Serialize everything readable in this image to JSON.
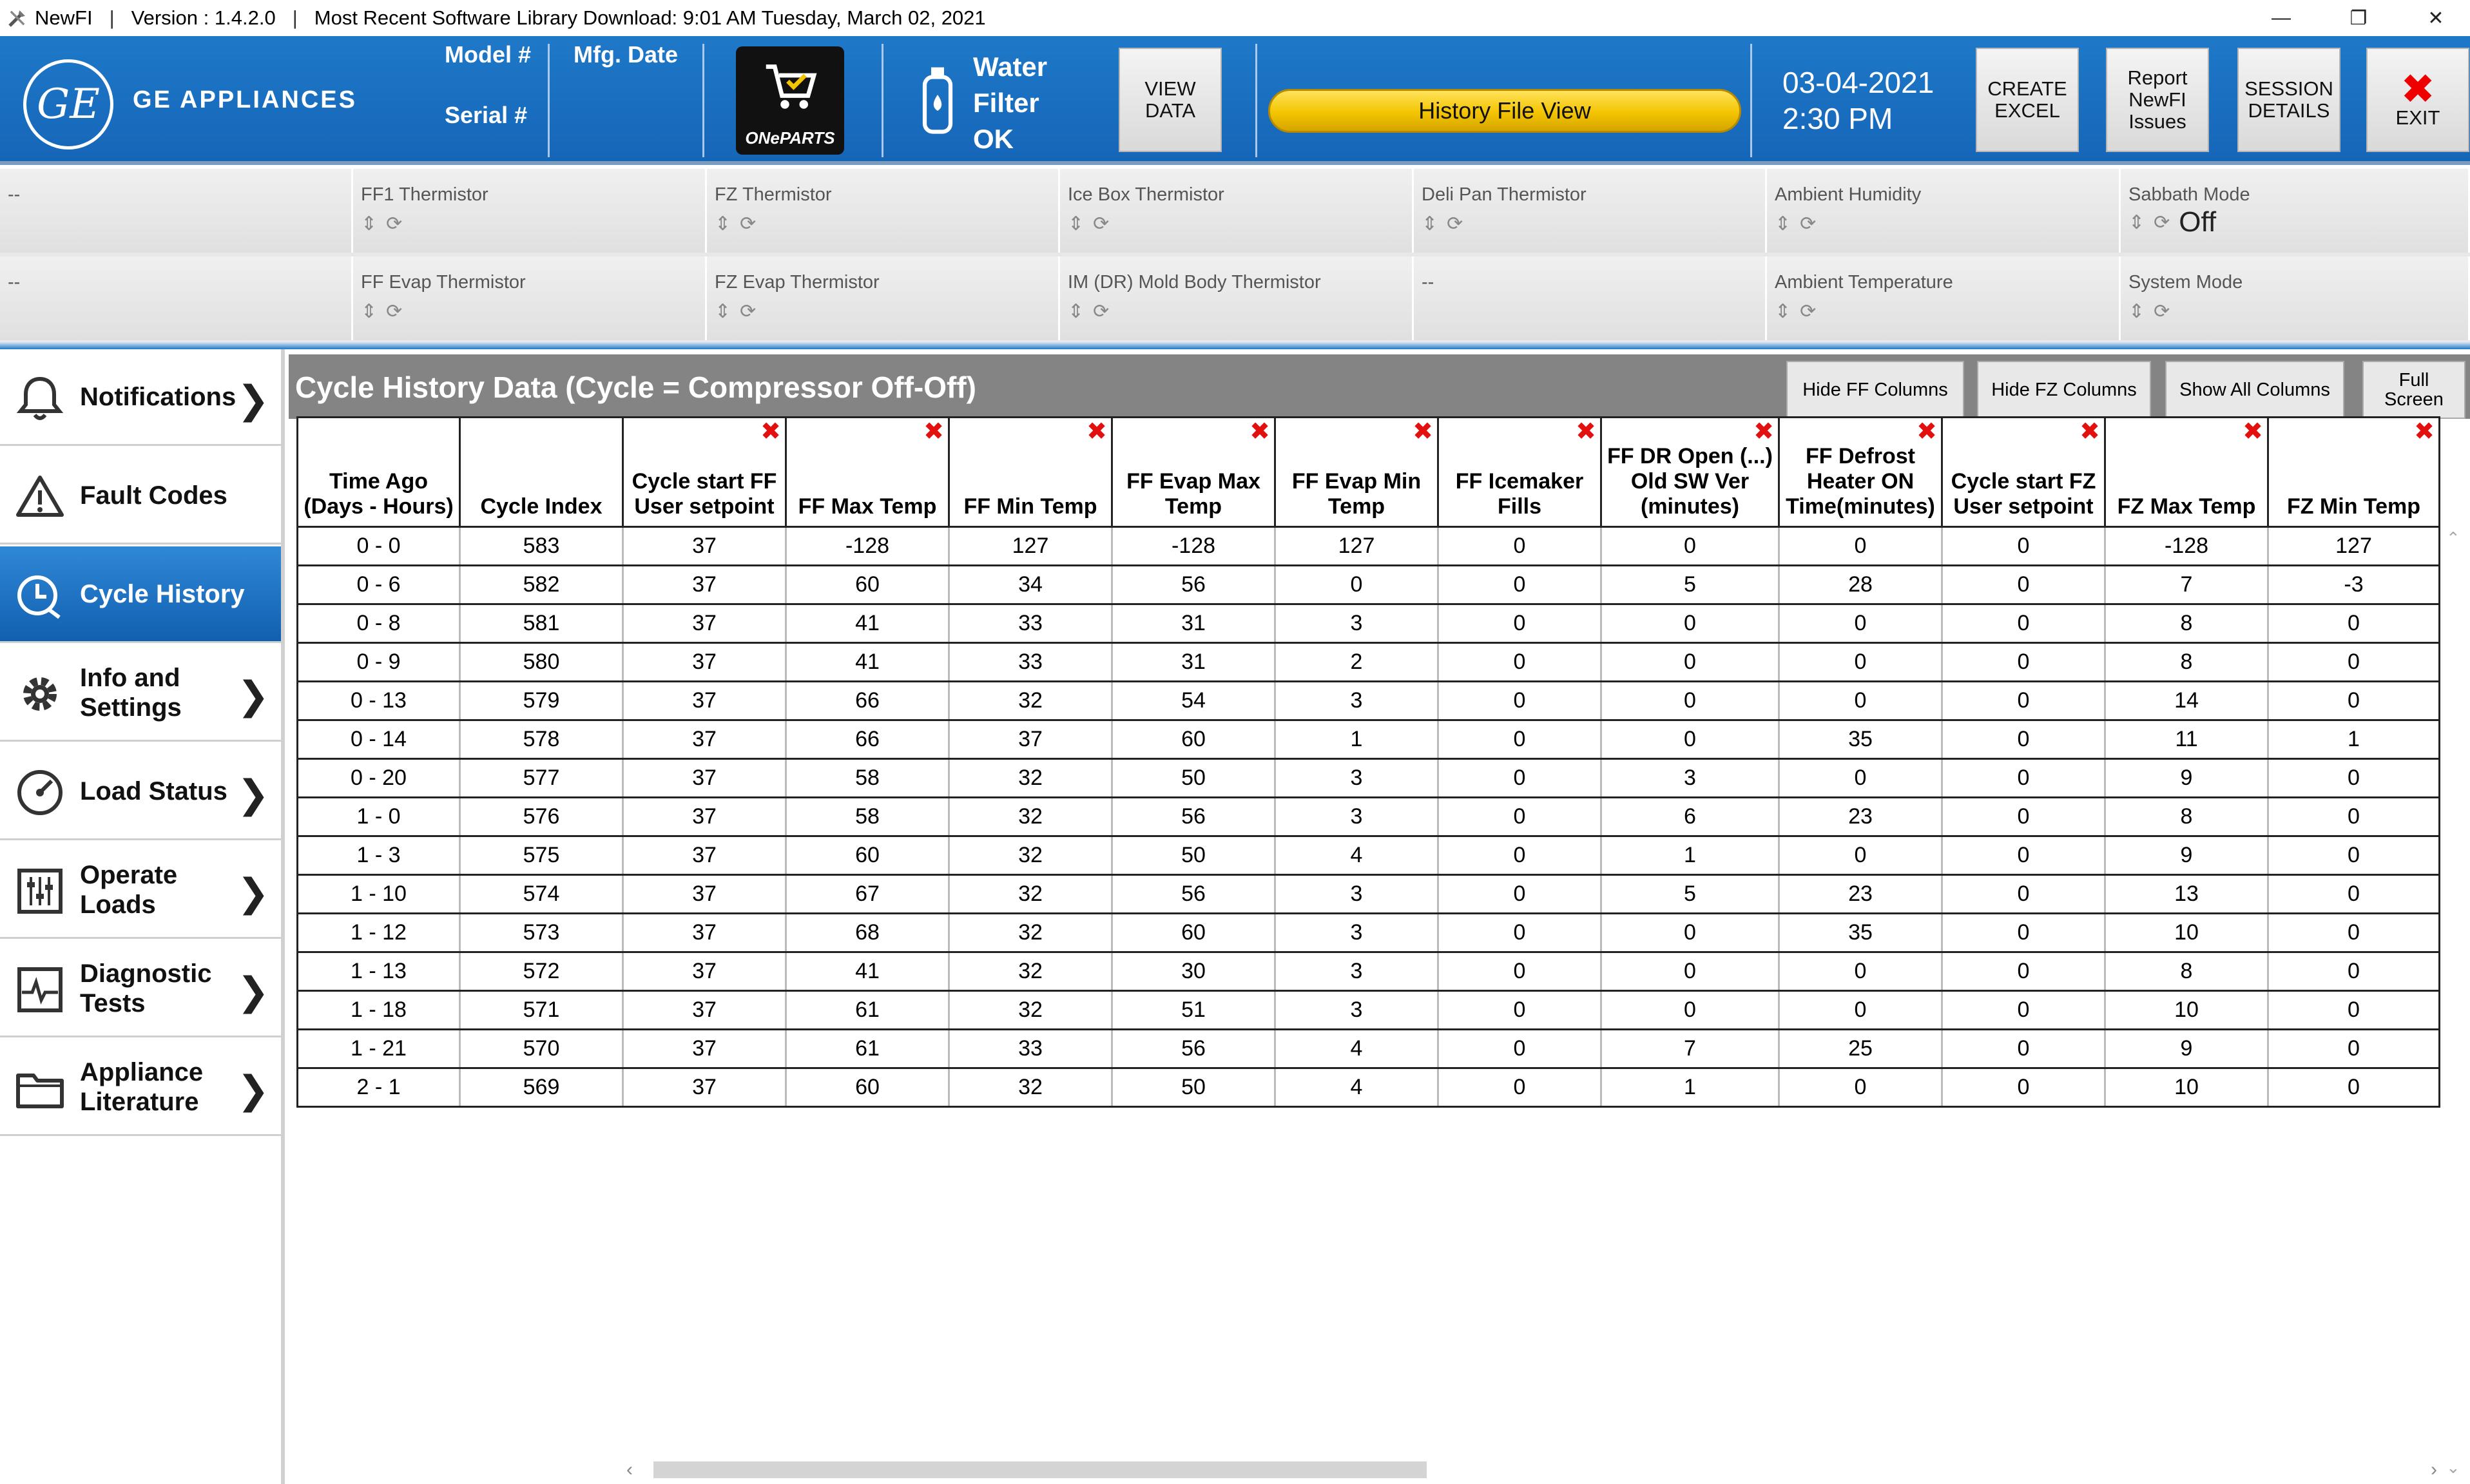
{
  "titlebar": {
    "app_name": "NewFI",
    "version": "Version : 1.4.2.0",
    "library_download": "Most Recent Software Library Download:  9:01 AM Tuesday, March 02, 2021"
  },
  "header": {
    "logo_text": "GE",
    "brand": "GE APPLIANCES",
    "model_label": "Model #",
    "serial_label": "Serial #",
    "mfg_label": "Mfg. Date",
    "oneparts_label": "ONePARTS",
    "water_line1": "Water",
    "water_line2": "Filter",
    "water_line3": "OK",
    "view_data": "VIEW\nDATA",
    "history_file": "History File View",
    "date": "03-04-2021",
    "time": "2:30 PM",
    "create_excel": "CREATE\nEXCEL",
    "report_issues": "Report\nNewFI\nIssues",
    "session_details": "SESSION\nDETAILS",
    "exit": "EXIT"
  },
  "status": {
    "row1": [
      {
        "label": "--",
        "value": ""
      },
      {
        "label": "FF1 Thermistor",
        "value": ""
      },
      {
        "label": "FZ Thermistor",
        "value": ""
      },
      {
        "label": "Ice Box Thermistor",
        "value": ""
      },
      {
        "label": "Deli Pan Thermistor",
        "value": ""
      },
      {
        "label": "Ambient Humidity",
        "value": ""
      },
      {
        "label": "Sabbath Mode",
        "value": "Off"
      }
    ],
    "row2": [
      {
        "label": "--",
        "value": ""
      },
      {
        "label": "FF Evap Thermistor",
        "value": ""
      },
      {
        "label": "FZ Evap Thermistor",
        "value": ""
      },
      {
        "label": "IM (DR) Mold Body Thermistor",
        "value": ""
      },
      {
        "label": "--",
        "value": ""
      },
      {
        "label": "Ambient Temperature",
        "value": ""
      },
      {
        "label": "System Mode",
        "value": ""
      }
    ]
  },
  "sidebar": {
    "items": [
      {
        "label": "Notifications"
      },
      {
        "label": "Fault Codes"
      },
      {
        "label": "Cycle History"
      },
      {
        "label": "Info and\nSettings"
      },
      {
        "label": "Load Status"
      },
      {
        "label": "Operate\nLoads"
      },
      {
        "label": "Diagnostic\nTests"
      },
      {
        "label": "Appliance\nLiterature"
      }
    ]
  },
  "grid": {
    "title": "Cycle History Data (Cycle = Compressor Off-Off)",
    "hide_ff": "Hide FF Columns",
    "hide_fz": "Hide FZ Columns",
    "show_all": "Show All Columns",
    "full_screen": "Full\nScreen",
    "columns": [
      "Time Ago (Days - Hours)",
      "Cycle Index",
      "Cycle start FF User setpoint",
      "FF Max Temp",
      "FF Min Temp",
      "FF Evap Max Temp",
      "FF Evap Min Temp",
      "FF Icemaker Fills",
      "FF DR Open (...) Old SW Ver (minutes)",
      "FF Defrost Heater ON Time(minutes)",
      "Cycle start FZ User setpoint",
      "FZ Max Temp",
      "FZ Min Temp"
    ],
    "rows": [
      [
        "0 - 0",
        "583",
        "37",
        "-128",
        "127",
        "-128",
        "127",
        "0",
        "0",
        "0",
        "0",
        "-128",
        "127"
      ],
      [
        "0 - 6",
        "582",
        "37",
        "60",
        "34",
        "56",
        "0",
        "0",
        "5",
        "28",
        "0",
        "7",
        "-3"
      ],
      [
        "0 - 8",
        "581",
        "37",
        "41",
        "33",
        "31",
        "3",
        "0",
        "0",
        "0",
        "0",
        "8",
        "0"
      ],
      [
        "0 - 9",
        "580",
        "37",
        "41",
        "33",
        "31",
        "2",
        "0",
        "0",
        "0",
        "0",
        "8",
        "0"
      ],
      [
        "0 - 13",
        "579",
        "37",
        "66",
        "32",
        "54",
        "3",
        "0",
        "0",
        "0",
        "0",
        "14",
        "0"
      ],
      [
        "0 - 14",
        "578",
        "37",
        "66",
        "37",
        "60",
        "1",
        "0",
        "0",
        "35",
        "0",
        "11",
        "1"
      ],
      [
        "0 - 20",
        "577",
        "37",
        "58",
        "32",
        "50",
        "3",
        "0",
        "3",
        "0",
        "0",
        "9",
        "0"
      ],
      [
        "1 - 0",
        "576",
        "37",
        "58",
        "32",
        "56",
        "3",
        "0",
        "6",
        "23",
        "0",
        "8",
        "0"
      ],
      [
        "1 - 3",
        "575",
        "37",
        "60",
        "32",
        "50",
        "4",
        "0",
        "1",
        "0",
        "0",
        "9",
        "0"
      ],
      [
        "1 - 10",
        "574",
        "37",
        "67",
        "32",
        "56",
        "3",
        "0",
        "5",
        "23",
        "0",
        "13",
        "0"
      ],
      [
        "1 - 12",
        "573",
        "37",
        "68",
        "32",
        "60",
        "3",
        "0",
        "0",
        "35",
        "0",
        "10",
        "0"
      ],
      [
        "1 - 13",
        "572",
        "37",
        "41",
        "32",
        "30",
        "3",
        "0",
        "0",
        "0",
        "0",
        "8",
        "0"
      ],
      [
        "1 - 18",
        "571",
        "37",
        "61",
        "32",
        "51",
        "3",
        "0",
        "0",
        "0",
        "0",
        "10",
        "0"
      ],
      [
        "1 - 21",
        "570",
        "37",
        "61",
        "33",
        "56",
        "4",
        "0",
        "7",
        "25",
        "0",
        "9",
        "0"
      ],
      [
        "2 - 1",
        "569",
        "37",
        "60",
        "32",
        "50",
        "4",
        "0",
        "1",
        "0",
        "0",
        "10",
        "0"
      ]
    ]
  }
}
